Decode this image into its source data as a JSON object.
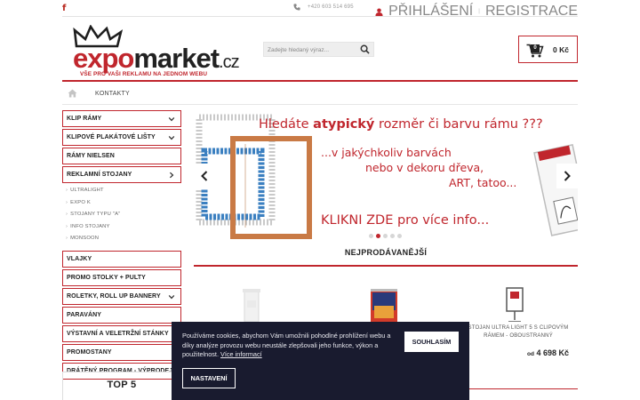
{
  "topbar": {
    "facebook_icon": "f",
    "phone": "+420 603 514 695",
    "login": "PŘIHLÁŠENÍ",
    "register": "REGISTRACE"
  },
  "logo": {
    "expo": "expo",
    "market": "market",
    "cz": ".cz",
    "tagline": "VŠE PRO VAŠI REKLAMU NA JEDNOM WEBU"
  },
  "search": {
    "placeholder": "Zadejte hledaný výraz..."
  },
  "cart": {
    "count": "0",
    "price": "0 Kč"
  },
  "breadcrumb": {
    "current": "KONTAKTY"
  },
  "sidebar": {
    "categories_a": [
      {
        "label": "KLIP RÁMY",
        "arrow": "down"
      },
      {
        "label": "KLIPOVÉ PLAKÁTOVÉ LIŠTY",
        "arrow": "down"
      },
      {
        "label": "RÁMY NIELSEN",
        "arrow": "none"
      },
      {
        "label": "REKLAMNÍ STOJANY",
        "arrow": "right"
      }
    ],
    "subitems": [
      "ULTRALIGHT",
      "EXPO K",
      "STOJANY TYPU \"A\"",
      "INFO STOJANY",
      "MONSOON"
    ],
    "categories_b": [
      {
        "label": "VLAJKY",
        "arrow": "none"
      },
      {
        "label": "PROMO STOLKY + PULTY",
        "arrow": "none"
      },
      {
        "label": "ROLETKY, ROLL UP BANNERY",
        "arrow": "down"
      },
      {
        "label": "PARAVÁNY",
        "arrow": "none"
      },
      {
        "label": "VÝSTAVNÍ A VELETRŽNÍ STÁNKY",
        "arrow": "none"
      },
      {
        "label": "PROMOSTANY",
        "arrow": "none"
      },
      {
        "label": "DRÁTĚNÝ PROGRAM - VÝPRODEJ",
        "arrow": "none"
      }
    ],
    "top5": "TOP 5"
  },
  "banner": {
    "headline_pre": "Hledáte ",
    "headline_bold": "atypický",
    "headline_post": " rozměr či barvu rámu ???",
    "line2": "...v jakýchkoliv barvách",
    "line3": "nebo v dekoru dřeva,",
    "line4": "ART, tatoo...",
    "cta": "KLIKNI ZDE pro více info...",
    "slides": 5,
    "active_slide": 2
  },
  "bestsellers": {
    "title": "NEJPRODÁVANĚJŠÍ",
    "products": [
      {
        "name": "",
        "price_prefix": "",
        "price": ""
      },
      {
        "name": "",
        "price_prefix": "",
        "price": ""
      },
      {
        "name": "STOJAN ULTRA LIGHT 5 S CLIPOVÝM RÁMEM - OBOUSTRANNÝ",
        "price_prefix": "od",
        "price": "4 698 Kč"
      }
    ]
  },
  "cookie": {
    "text": "Používáme cookies, abychom Vám umožnili pohodlné prohlížení webu a díky analýze provozu webu neustále zlepšovali jeho funkce, výkon a použitelnost.",
    "link": "Více informací",
    "accept": "SOUHLASÍM",
    "settings": "NASTAVENÍ"
  },
  "colors": {
    "accent": "#c0262d",
    "cookie_bg": "#191b2f"
  }
}
